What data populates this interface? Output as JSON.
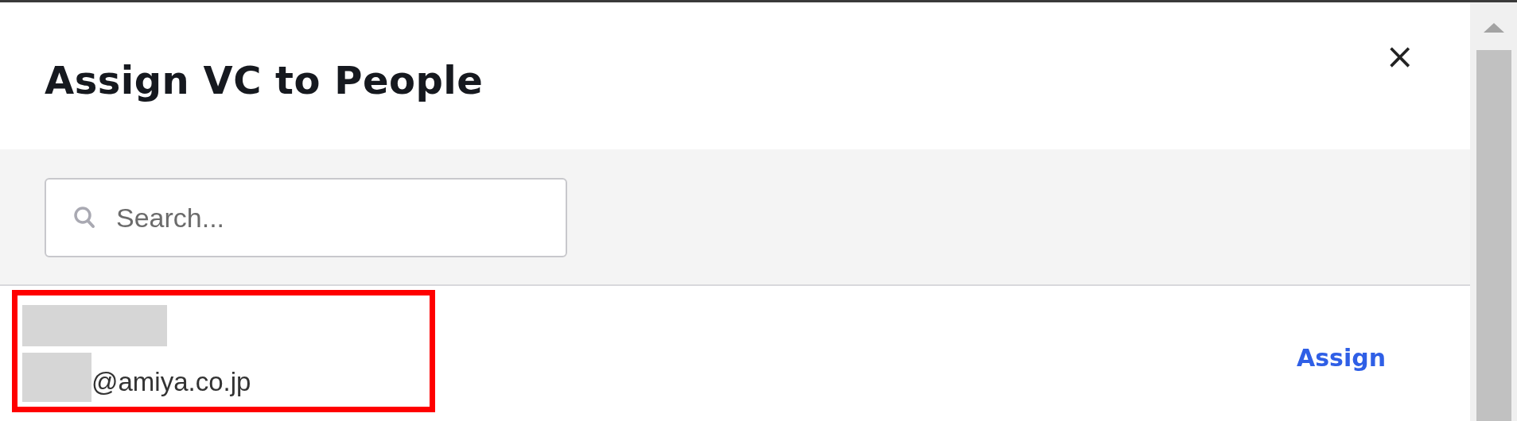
{
  "dialog": {
    "title": "Assign VC to People",
    "close": "×"
  },
  "search": {
    "placeholder": "Search..."
  },
  "people": [
    {
      "email": "@amiya.co.jp",
      "highlighted": true,
      "action": "Assign"
    }
  ]
}
